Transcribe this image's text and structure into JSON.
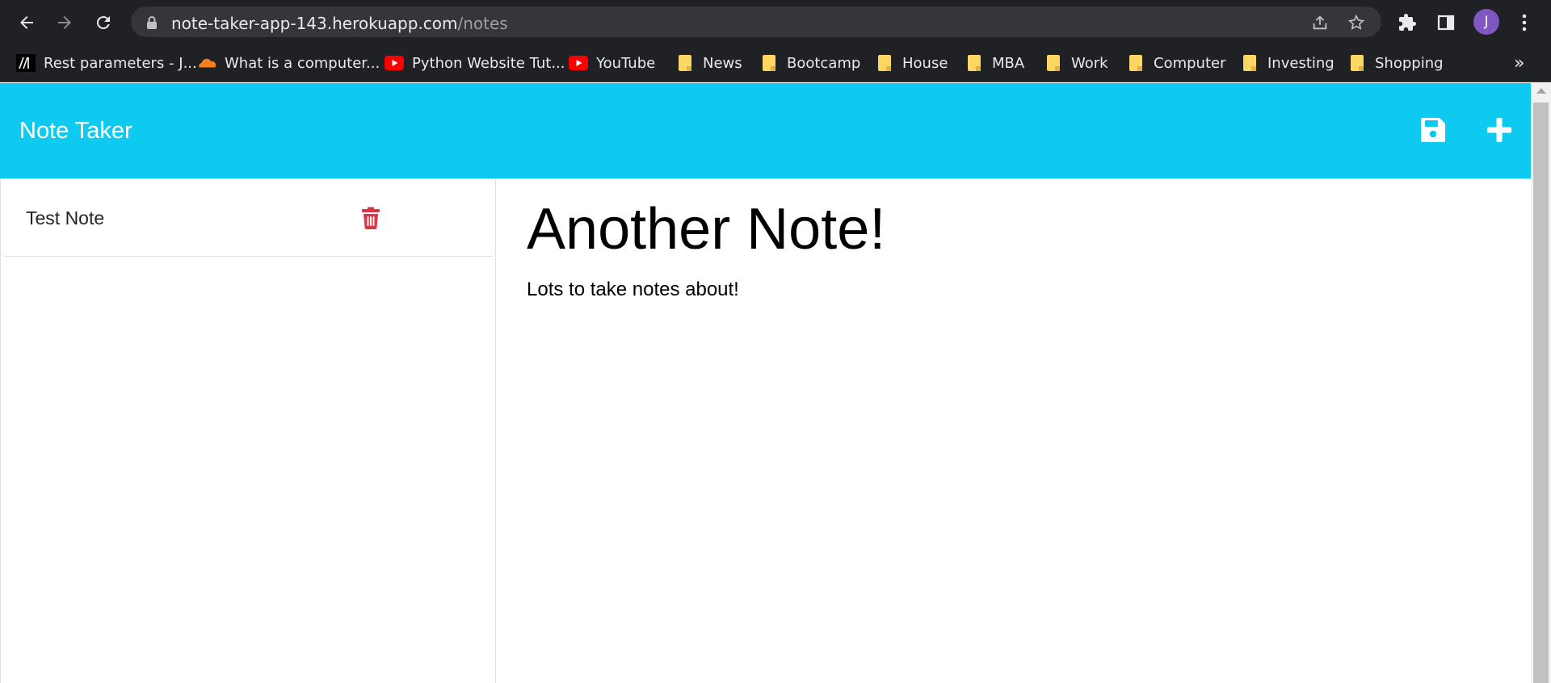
{
  "browser": {
    "url_host": "note-taker-app-143.herokuapp.com",
    "url_path": "/notes",
    "avatar_letter": "J",
    "bookmarks": [
      {
        "label": "Rest parameters - J...",
        "icon": "mdn-icon"
      },
      {
        "label": "What is a computer...",
        "icon": "cloudflare-icon"
      },
      {
        "label": "Python Website Tut...",
        "icon": "youtube-icon"
      },
      {
        "label": "YouTube",
        "icon": "youtube-icon"
      },
      {
        "label": "News",
        "icon": "folder-icon"
      },
      {
        "label": "Bootcamp",
        "icon": "folder-icon"
      },
      {
        "label": "House",
        "icon": "folder-icon"
      },
      {
        "label": "MBA",
        "icon": "folder-icon"
      },
      {
        "label": "Work",
        "icon": "folder-icon"
      },
      {
        "label": "Computer",
        "icon": "folder-icon"
      },
      {
        "label": "Investing",
        "icon": "folder-icon"
      },
      {
        "label": "Shopping",
        "icon": "folder-icon"
      }
    ],
    "more_label": "»"
  },
  "app": {
    "title": "Note Taker",
    "header_color": "#0ecaf0",
    "delete_color": "#dc3545"
  },
  "notes": [
    {
      "title": "Test Note"
    }
  ],
  "editor": {
    "title": "Another Note!",
    "body": "Lots to take notes about!"
  }
}
